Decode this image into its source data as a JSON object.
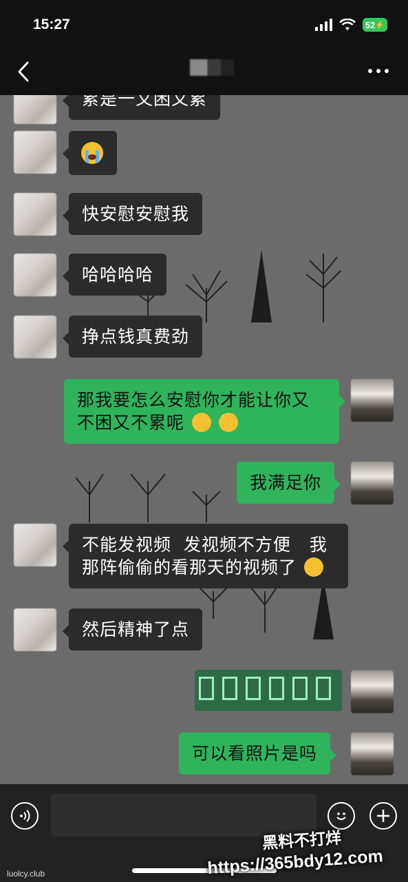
{
  "status_bar": {
    "time": "15:27",
    "battery": "52"
  },
  "nav": {
    "back_icon": "chevron-left-icon",
    "more_icon": "more-dots-icon"
  },
  "messages": [
    {
      "side": "left",
      "text": "累是一又困又累"
    },
    {
      "side": "left",
      "text": "",
      "emoji": "loudly-crying-face"
    },
    {
      "side": "left",
      "text": "快安慰安慰我"
    },
    {
      "side": "left",
      "text": "哈哈哈哈"
    },
    {
      "side": "left",
      "text": "挣点钱真费劲"
    },
    {
      "side": "right",
      "line1": "那我要怎么安慰你才能让你又",
      "line2": "不困又不累呢",
      "emoji": "face-with-hand-over-mouth"
    },
    {
      "side": "right",
      "text": "我满足你"
    },
    {
      "side": "left",
      "line1": "不能发视频  发视频不方便   我",
      "line2": "那阵偷偷的看那天的视频了",
      "emoji": "grinning-face"
    },
    {
      "side": "left",
      "text": "然后精神了点"
    },
    {
      "side": "right",
      "text": "",
      "sticker": "green-sticker-image"
    },
    {
      "side": "right",
      "text": "可以看照片是吗"
    }
  ],
  "input_bar": {
    "voice_icon": "voice-icon",
    "emoji_icon": "emoji-icon",
    "plus_icon": "plus-icon"
  },
  "watermarks": {
    "left": "luolcy.club",
    "right_line1": "黑料不打烊",
    "right_line2": "https://365bdy12.com"
  },
  "colors": {
    "right_bubble": "#2fb35b",
    "left_bubble": "#2b2b2b",
    "background": "#6b6b6b",
    "battery": "#34c759"
  }
}
